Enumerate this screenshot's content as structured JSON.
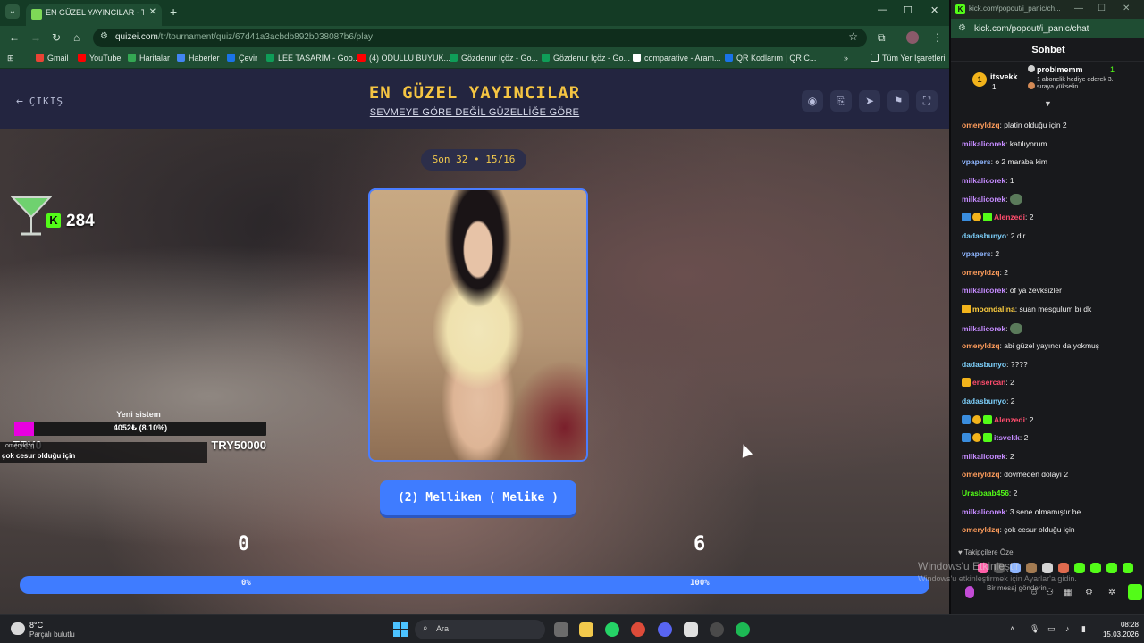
{
  "browser": {
    "tab_title": "EN GÜZEL YAYINCILAR - Tier Li",
    "url_host": "quizei.com",
    "url_path": "/tr/tournament/quiz/67d41a3acbdb892b038087b6/play",
    "bookmarks": [
      "Gmail",
      "YouTube",
      "Haritalar",
      "Haberler",
      "Çevir",
      "LEE TASARIM - Goo...",
      "(4) ÖDÜLLÜ BÜYÜK...",
      "Gözdenur İçöz - Go...",
      "Gözdenur İçöz - Go...",
      "comparative - Aram...",
      "QR Kodlarım | QR C..."
    ],
    "bookmarks_more": "»",
    "bookmarks_all": "Tüm Yer İşaretleri"
  },
  "quiz": {
    "exit_label": "ÇIKIŞ",
    "title": "EN GÜZEL YAYINCILAR",
    "subtitle": "SEVMEYE GÖRE DEĞİL GÜZELLİĞE GÖRE",
    "round_label": "Son 32 • 15/16",
    "candidate_name": "(2) Melliken ( Melike )",
    "score_left": "0",
    "score_right": "6",
    "progress_left_label": "0%",
    "progress_right_label": "100%",
    "progress_right_fraction": 1.0
  },
  "overlay": {
    "kick_points": "284",
    "goal_title": "Yeni sistem",
    "goal_value": "4052₺ (8.10%)",
    "goal_fraction": 0.081,
    "goal_min": "TRY0",
    "goal_max": "TRY50000",
    "tts_user": "omeryldzq",
    "tts_message": "çok cesur olduğu için"
  },
  "popup": {
    "window_title": "kick.com/popout/i_panic/ch...",
    "url": "kick.com/popout/i_panic/chat",
    "chat_title": "Sohbet",
    "pinned_left_name": "itsvekk",
    "pinned_left_count": "1",
    "pinned_right_name": "probImemm",
    "pinned_right_count": "1",
    "pinned_right_text": "1 abonelik hediye ederek 3. sıraya yükselin",
    "follower_only": "Takipçilere Özel",
    "send_placeholder": "Bir mesaj gönderin",
    "watermark_title": "Windows'u Etkinleştir",
    "watermark_text": "Windows'u etkinleştirmek için Ayarlar'a gidin."
  },
  "chat": [
    {
      "user": "omeryldzq",
      "color": "#ff9d5c",
      "text": "platin olduğu için 2"
    },
    {
      "user": "milkalicorek",
      "color": "#c58bff",
      "text": "katılıyorum"
    },
    {
      "user": "vpapers",
      "color": "#8fb6ff",
      "text": "o 2 maraba kim"
    },
    {
      "user": "milkalicorek",
      "color": "#c58bff",
      "text": "1"
    },
    {
      "user": "milkalicorek",
      "color": "#c58bff",
      "text": "",
      "emote": true
    },
    {
      "user": "Alenzedi",
      "color": "#ff4d6d",
      "text": "2",
      "badges": true
    },
    {
      "user": "dadasbunyo",
      "color": "#7fd3ff",
      "text": "2 dir"
    },
    {
      "user": "vpapers",
      "color": "#8fb6ff",
      "text": "2"
    },
    {
      "user": "omeryldzq",
      "color": "#ff9d5c",
      "text": "2"
    },
    {
      "user": "milkalicorek",
      "color": "#c58bff",
      "text": "öf ya zevksizler"
    },
    {
      "user": "moondalina",
      "color": "#ffcf3f",
      "text": "suan mesgulum bı dk",
      "crown": true
    },
    {
      "user": "milkalicorek",
      "color": "#c58bff",
      "text": "",
      "emote": true
    },
    {
      "user": "omeryldzq",
      "color": "#ff9d5c",
      "text": "abi güzel yayıncı da yokmuş"
    },
    {
      "user": "dadasbunyo",
      "color": "#7fd3ff",
      "text": "????"
    },
    {
      "user": "ensercan",
      "color": "#ff4d6d",
      "text": "2",
      "crown": true
    },
    {
      "user": "dadasbunyo",
      "color": "#7fd3ff",
      "text": "2"
    },
    {
      "user": "Alenzedi",
      "color": "#ff4d6d",
      "text": "2",
      "badges": true
    },
    {
      "user": "itsvekk",
      "color": "#c58bff",
      "text": "2",
      "badges": true
    },
    {
      "user": "milkalicorek",
      "color": "#c58bff",
      "text": "2"
    },
    {
      "user": "omeryldzq",
      "color": "#ff9d5c",
      "text": "dövmeden dolayı 2"
    },
    {
      "user": "Urasbaab456",
      "color": "#53fc18",
      "text": "2"
    },
    {
      "user": "milkalicorek",
      "color": "#c58bff",
      "text": "3 sene olmamıştır be"
    },
    {
      "user": "omeryldzq",
      "color": "#ff9d5c",
      "text": "çok cesur olduğu için"
    }
  ],
  "taskbar": {
    "weather_temp": "8°C",
    "weather_desc": "Parçalı bulutlu",
    "search_label": "Ara",
    "time": "08:28",
    "date": "15.03.2026"
  },
  "colors": {
    "accent_blue": "#3f7cff",
    "title_gold": "#f5c542",
    "kick_green": "#53fc18",
    "goal_magenta": "#e800e0"
  }
}
